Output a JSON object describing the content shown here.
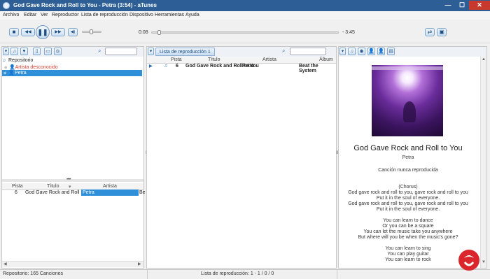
{
  "window": {
    "title": "God Gave Rock and Roll to You - Petra (3:54) - aTunes",
    "minimize": "—",
    "maximize": "☐",
    "close": "✕"
  },
  "menu": [
    "Archivo",
    "Editar",
    "Ver",
    "Reproductor",
    "Lista de reproducción",
    "Dispositivo",
    "Herramientas",
    "Ayuda"
  ],
  "player": {
    "elapsed": "0:08",
    "remaining": "- 3:45",
    "progress": 0.035,
    "volume": 0.4,
    "icons": {
      "stop": "■",
      "previous": "◀◀",
      "pause": "❚❚",
      "next": "▶▶",
      "volume": "◀)",
      "repeat": "⇄",
      "fullscreen": "▣"
    }
  },
  "navigator": {
    "tree": [
      {
        "label": "Repositorio",
        "icon": "♫"
      },
      {
        "label": "Artista desconocido",
        "icon": "👤"
      },
      {
        "label": "Petra",
        "icon": "👤"
      }
    ],
    "colors": {
      "unknown_artist": "#d23b2e",
      "selection": "#2f8fd8"
    },
    "columns": [
      "Pista",
      "Título",
      "Artista"
    ],
    "rows": [
      {
        "track": "6",
        "title": "God Gave Rock and Roll",
        "artist": "Petra",
        "extra": "Be"
      }
    ],
    "toolbar_icons": {
      "view": "♫",
      "favorite": "♥",
      "device": "▯",
      "radio": "▭",
      "podcast": "◎"
    }
  },
  "playlist": {
    "tab": "Lista de reproducción 1",
    "columns": [
      "Pista",
      "Título",
      "Artista",
      "Álbum"
    ],
    "rows": [
      {
        "playing": "▶",
        "icon": "♫",
        "track": "6",
        "title": "God Gave Rock and Roll to You",
        "artist": "Petra",
        "album": "Beat the System"
      }
    ]
  },
  "context": {
    "song_title": "God Gave Rock and Roll to You",
    "artist": "Petra",
    "play_status": "Canción nunca reproducida",
    "lyrics": [
      "(Chorus)",
      "God gave rock and roll to you, gave rock and roll to you",
      "Put it in the soul of everyone.",
      "God gave rock and roll to you, gave rock and roll to you",
      "Put it in the soul of everyone.",
      "",
      "You can learn to dance",
      "Or you can be a square",
      "You can let the music take you anywhere",
      "But where will you be when the music's gone?",
      "",
      "You can learn to sing",
      "You can play guitar",
      "You can learn to rock"
    ]
  },
  "status": {
    "left": "Repositorio: 165 Canciones",
    "center": "Lista de reproducción: 1 - 1 / 0 / 0"
  },
  "watermark": {
    "text": "solvetic.com"
  }
}
